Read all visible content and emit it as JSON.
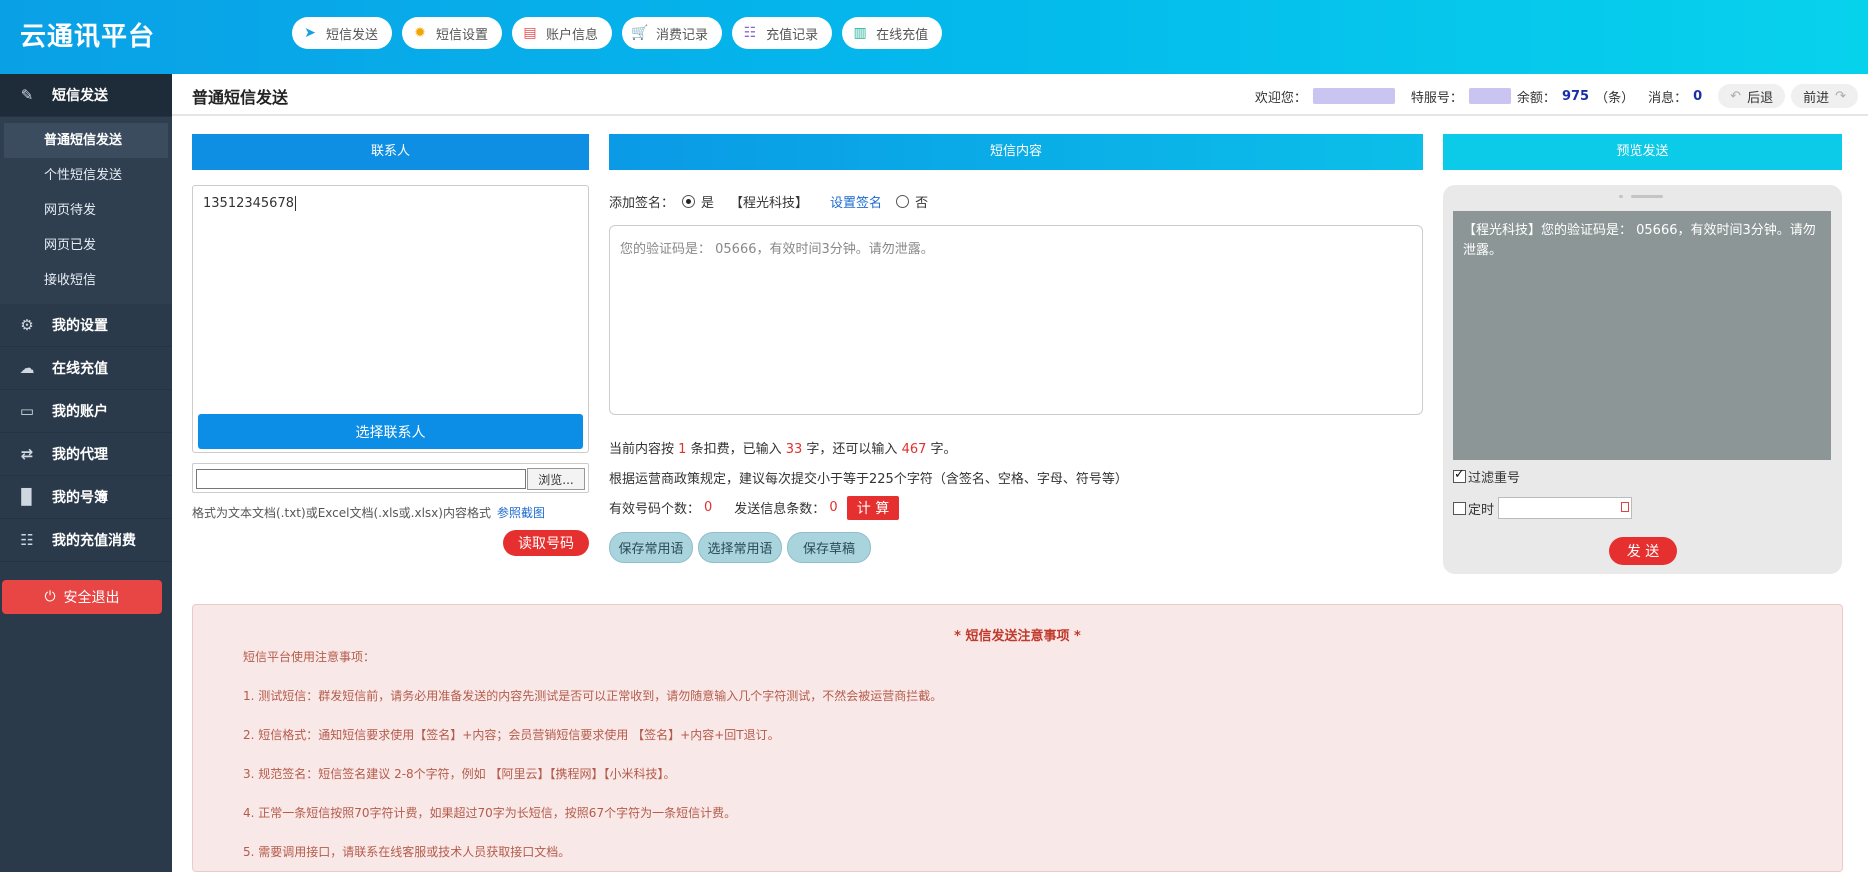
{
  "brand": "云通讯平台",
  "topnav": [
    {
      "label": "短信发送",
      "icon": "paper-plane-icon"
    },
    {
      "label": "短信设置",
      "icon": "gear-icon"
    },
    {
      "label": "账户信息",
      "icon": "document-icon"
    },
    {
      "label": "消费记录",
      "icon": "cart-icon"
    },
    {
      "label": "充值记录",
      "icon": "grid-list-icon"
    },
    {
      "label": "在线充值",
      "icon": "book-icon"
    }
  ],
  "sidebar": {
    "sections": [
      {
        "label": "短信发送",
        "icon": "edit-icon"
      },
      {
        "label": "我的设置",
        "icon": "gear-icon"
      },
      {
        "label": "在线充值",
        "icon": "cloud-icon"
      },
      {
        "label": "我的账户",
        "icon": "monitor-icon"
      },
      {
        "label": "我的代理",
        "icon": "shuffle-icon"
      },
      {
        "label": "我的号簿",
        "icon": "book-icon"
      },
      {
        "label": "我的充值消费",
        "icon": "grid-list-icon"
      }
    ],
    "sub_items": [
      "普通短信发送",
      "个性短信发送",
      "网页待发",
      "网页已发",
      "接收短信"
    ],
    "logout": "安全退出"
  },
  "pagebar": {
    "title": "普通短信发送",
    "welcome": "欢迎您：",
    "service_no": "特服号：",
    "balance_label": "余额：",
    "balance": "975",
    "balance_unit": "（条）",
    "messages_label": "消息：",
    "messages": "0",
    "back": "后退",
    "forward": "前进"
  },
  "contacts": {
    "header": "联系人",
    "value": "13512345678",
    "select_button": "选择联系人",
    "browse": "浏览...",
    "format_note": "格式为文本文档(.txt)或Excel文档(.xls或.xlsx)内容格式",
    "format_link": "参照截图",
    "read_button": "读取号码"
  },
  "sms": {
    "header": "短信内容",
    "sig_label": "添加签名：",
    "yes": "是",
    "signature": "【程光科技】",
    "set_sig": "设置签名",
    "no": "否",
    "placeholder": "您的验证码是： 05666，有效时间3分钟。请勿泄露。",
    "count_pre": "当前内容按",
    "count_bill": "1",
    "count_mid": "条扣费，已输入",
    "count_typed": "33",
    "count_mid2": "字，还可以输入",
    "count_left": "467",
    "count_post": "字。",
    "policy": "根据运营商政策规定，建议每次提交小于等于225个字符（含签名、空格、字母、符号等）",
    "valid_label": "有效号码个数：",
    "valid_count": "0",
    "send_label": "发送信息条数：",
    "send_count": "0",
    "calc_button": "计 算",
    "save_common": "保存常用语",
    "select_common": "选择常用语",
    "save_draft": "保存草稿"
  },
  "preview": {
    "header": "预览发送",
    "message": "【程光科技】您的验证码是： 05666，有效时间3分钟。请勿泄露。",
    "filter": "过滤重号",
    "timer": "定时",
    "send_button": "发 送"
  },
  "notice": {
    "title": "* 短信发送注意事项 *",
    "intro": "短信平台使用注意事项：",
    "items": [
      "1. 测试短信：群发短信前，请务必用准备发送的内容先测试是否可以正常收到，请勿随意输入几个字符测试，不然会被运营商拦截。",
      "2. 短信格式：通知短信要求使用【签名】+内容；会员营销短信要求使用 【签名】+内容+回T退订。",
      "3. 规范签名：短信签名建议 2-8个字符，例如 【阿里云】【携程网】【小米科技】。",
      "4. 正常一条短信按照70字符计费，如果超过70字为长短信，按照67个字符为一条短信计费。",
      "5. 需要调用接口，请联系在线客服或技术人员获取接口文档。"
    ]
  },
  "colors": {
    "header_start": "#0aa0e6",
    "header_end": "#07d2ec",
    "sidebar": "#2b3a4a",
    "accent_red": "#e63030",
    "primary_blue": "#0d8ee6"
  }
}
